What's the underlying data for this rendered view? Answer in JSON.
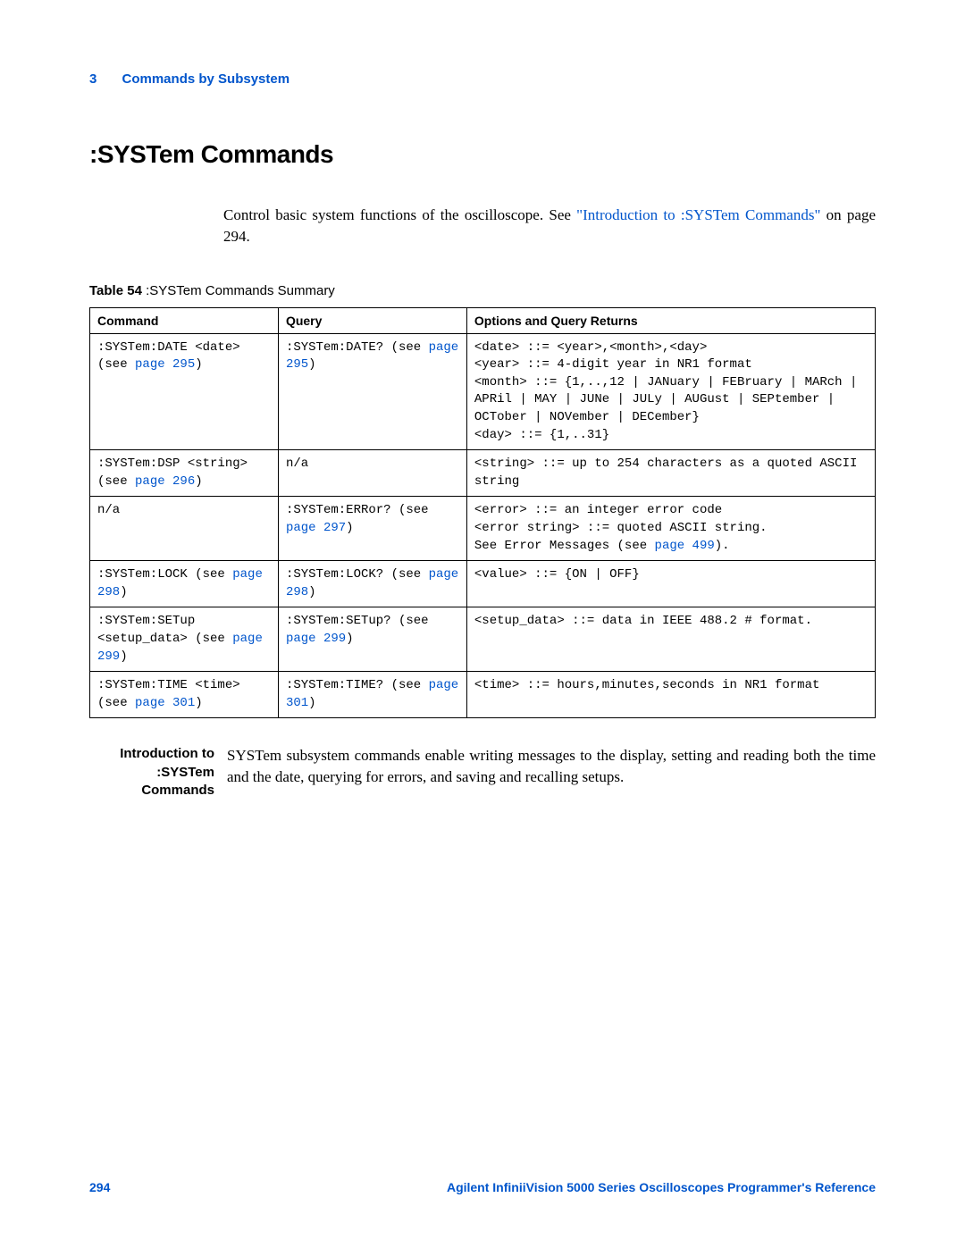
{
  "chapter": {
    "num": "3",
    "title": "Commands by Subsystem"
  },
  "section_title": ":SYSTem Commands",
  "intro": {
    "pre": "Control basic system functions of the oscilloscope. See ",
    "link": "\"Introduction to :SYSTem Commands\"",
    "post": " on page 294."
  },
  "table_caption": {
    "label": "Table 54",
    "text": "   :SYSTem Commands Summary"
  },
  "headers": {
    "cmd": "Command",
    "query": "Query",
    "opts": "Options and Query Returns"
  },
  "rows": [
    {
      "cmd_pre": ":SYSTem:DATE <date> (see ",
      "cmd_link": "page 295",
      "cmd_post": ")",
      "q_pre": ":SYSTem:DATE? (see ",
      "q_link": "page 295",
      "q_post": ")",
      "opts": "<date> ::= <year>,<month>,<day>\n<year> ::= 4-digit year in NR1 format\n<month> ::= {1,..,12 | JANuary | FEBruary | MARch | APRil | MAY | JUNe | JULy | AUGust | SEPtember | OCTober | NOVember | DECember}\n<day> ::= {1,..31}"
    },
    {
      "cmd_pre": ":SYSTem:DSP <string> (see ",
      "cmd_link": "page 296",
      "cmd_post": ")",
      "q_pre": "n/a",
      "q_link": "",
      "q_post": "",
      "opts": "<string> ::= up to 254 characters as a quoted ASCII string"
    },
    {
      "cmd_pre": "n/a",
      "cmd_link": "",
      "cmd_post": "",
      "q_pre": ":SYSTem:ERRor? (see ",
      "q_link": "page 297",
      "q_post": ")",
      "opts_pre": "<error> ::= an integer error code\n<error string> ::= quoted ASCII string.\nSee Error Messages (see ",
      "opts_link": "page 499",
      "opts_post": ")."
    },
    {
      "cmd_pre": ":SYSTem:LOCK (see ",
      "cmd_link": "page 298",
      "cmd_post": ")",
      "q_pre": ":SYSTem:LOCK? (see ",
      "q_link": "page 298",
      "q_post": ")",
      "opts": "<value> ::= {ON | OFF}"
    },
    {
      "cmd_pre": ":SYSTem:SETup <setup_data> (see ",
      "cmd_link": "page 299",
      "cmd_post": ")",
      "q_pre": ":SYSTem:SETup? (see ",
      "q_link": "page 299",
      "q_post": ")",
      "opts": "<setup_data> ::= data in IEEE 488.2 # format."
    },
    {
      "cmd_pre": ":SYSTem:TIME <time> (see ",
      "cmd_link": "page 301",
      "cmd_post": ")",
      "q_pre": ":SYSTem:TIME? (see ",
      "q_link": "page 301",
      "q_post": ")",
      "opts": "<time> ::= hours,minutes,seconds in NR1 format"
    }
  ],
  "side": {
    "label": "Introduction to :SYSTem Commands",
    "body": "SYSTem subsystem commands enable writing messages to the display, setting and reading both the time and the date, querying for errors, and saving and recalling setups."
  },
  "footer": {
    "page": "294",
    "ref": "Agilent InfiniiVision 5000 Series Oscilloscopes Programmer's Reference"
  }
}
